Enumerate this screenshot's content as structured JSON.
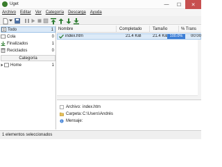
{
  "window": {
    "title": "Uget",
    "minimize": "—",
    "maximize": "☐",
    "close": "✕"
  },
  "menu": [
    "Archivo",
    "Editar",
    "Ver",
    "Categoría",
    "Descarga",
    "Ayuda"
  ],
  "sidebar": {
    "states": [
      {
        "label": "Todo",
        "count": "1"
      },
      {
        "label": "Cola",
        "count": "0"
      },
      {
        "label": "Finalizados",
        "count": "1"
      },
      {
        "label": "Reciclados",
        "count": "0"
      }
    ],
    "category_header": "Categoría",
    "categories": [
      {
        "label": "Home",
        "count": "1"
      }
    ]
  },
  "table": {
    "columns": [
      "Nombre",
      "Completado",
      "Tamaño",
      "% Trans"
    ],
    "rows": [
      {
        "name": "index.htm",
        "completed": "21.4 KiB",
        "size": "21.4 KiB",
        "progress": "100.0%",
        "extra": "00:00"
      }
    ]
  },
  "details": {
    "file_label": "Archivo:",
    "file_value": "index.htm",
    "folder_label": "Carpeta:",
    "folder_value": "C:\\Users\\Andrés",
    "message_label": "Mensaje:",
    "message_value": ""
  },
  "status": {
    "text": "1 elementos seleccionados"
  },
  "colors": {
    "accent": "#3d7fd6",
    "selection": "#dceaf8",
    "close": "#c75050",
    "icon_green": "#3a7d2c"
  }
}
